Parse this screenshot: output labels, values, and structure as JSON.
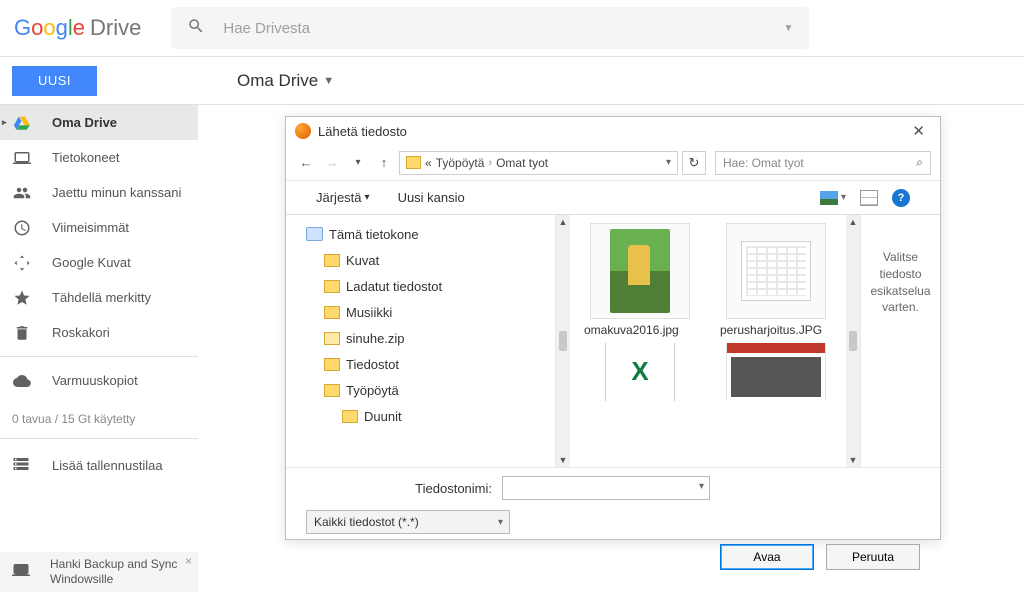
{
  "header": {
    "logo_drive": "Drive",
    "search_placeholder": "Hae Drivesta"
  },
  "secondbar": {
    "new_btn": "UUSI",
    "breadcrumb": "Oma Drive"
  },
  "sidebar": {
    "items": [
      {
        "label": "Oma Drive",
        "icon": "drive-icon",
        "selected": true
      },
      {
        "label": "Tietokoneet",
        "icon": "computers-icon"
      },
      {
        "label": "Jaettu minun kanssani",
        "icon": "shared-icon"
      },
      {
        "label": "Viimeisimmät",
        "icon": "recent-icon"
      },
      {
        "label": "Google Kuvat",
        "icon": "photos-icon"
      },
      {
        "label": "Tähdellä merkitty",
        "icon": "star-icon"
      },
      {
        "label": "Roskakori",
        "icon": "trash-icon"
      }
    ],
    "backups": "Varmuuskopiot",
    "storage_text": "0 tavua / 15 Gt käytetty",
    "more_storage": "Lisää tallennustilaa",
    "backup_tip": "Hanki Backup and Sync Windowsille"
  },
  "dialog": {
    "title": "Lähetä tiedosto",
    "path_segments": [
      "Työpöytä",
      "Omat tyot"
    ],
    "search_placeholder": "Hae: Omat tyot",
    "toolbar": {
      "sort": "Järjestä",
      "new_folder": "Uusi kansio"
    },
    "tree": [
      {
        "label": "Tämä tietokone",
        "type": "pc",
        "indent": 0
      },
      {
        "label": "Kuvat",
        "type": "folder",
        "indent": 1
      },
      {
        "label": "Ladatut tiedostot",
        "type": "folder",
        "indent": 1
      },
      {
        "label": "Musiikki",
        "type": "folder",
        "indent": 1
      },
      {
        "label": "sinuhe.zip",
        "type": "zip",
        "indent": 1
      },
      {
        "label": "Tiedostot",
        "type": "folder",
        "indent": 1
      },
      {
        "label": "Työpöytä",
        "type": "folder",
        "indent": 1
      },
      {
        "label": "Duunit",
        "type": "folder",
        "indent": 2
      }
    ],
    "files": [
      {
        "name": "omakuva2016.jpg",
        "thumb": "photo"
      },
      {
        "name": "perusharjoitus.JPG",
        "thumb": "xls"
      },
      {
        "name": "",
        "thumb": "xldoc"
      },
      {
        "name": "",
        "thumb": "news"
      }
    ],
    "preview_text": "Valitse tiedosto esikatselua varten.",
    "filename_label": "Tiedostonimi:",
    "filetype_label": "Kaikki tiedostot (*.*)",
    "open_btn": "Avaa",
    "cancel_btn": "Peruuta"
  }
}
